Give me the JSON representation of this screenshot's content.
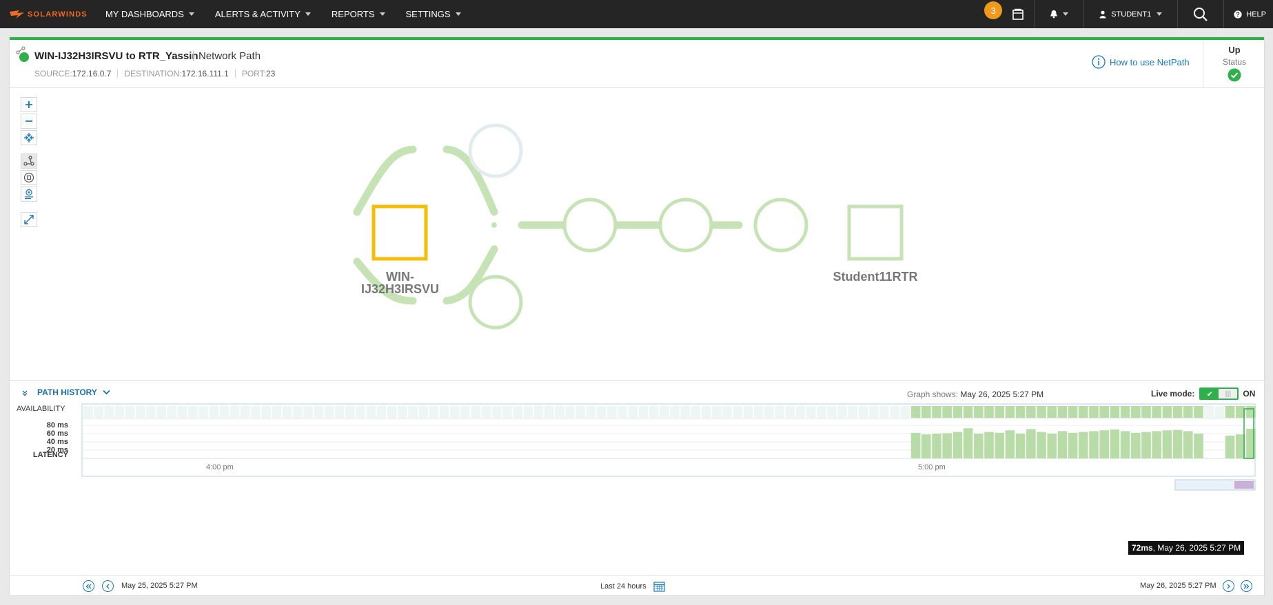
{
  "brand": {
    "name": "SOLARWINDS",
    "color": "#f16a21"
  },
  "nav": {
    "menus": [
      "MY DASHBOARDS",
      "ALERTS & ACTIVITY",
      "REPORTS",
      "SETTINGS"
    ],
    "notification_count": "3",
    "user": "STUDENT1",
    "help": "HELP"
  },
  "header": {
    "title": "WIN-IJ32H3IRSVU to RTR_Yassin",
    "subtitle": "Network Path",
    "source_label": "SOURCE:",
    "source": "172.16.0.7",
    "destination_label": "DESTINATION:",
    "destination": "172.16.111.1",
    "port_label": "PORT:",
    "port": "23",
    "how_to": "How to use NetPath",
    "status_value": "Up",
    "status_label": "Status"
  },
  "map": {
    "source_node": "WIN-\nIJ32H3IRSVU",
    "dest_node": "Student11RTR",
    "colors": {
      "path": "#c5e3b5",
      "source_border": "#f5bd06",
      "unknown_hop": "#e2ecf0"
    }
  },
  "history": {
    "title": "PATH HISTORY",
    "graph_shows_label": "Graph shows:",
    "graph_shows_value": "May 26, 2025 5:27 PM",
    "live_mode_label": "Live mode:",
    "live_mode_state": "ON",
    "availability_label": "AVAILABILITY",
    "latency_label": "LATENCY",
    "latency_ticks": [
      "80 ms",
      "60 ms",
      "40 ms",
      "20 ms"
    ],
    "time_labels": [
      "4:00 pm",
      "5:00 pm"
    ],
    "tooltip_value": "72ms",
    "tooltip_time": ", May 26, 2025 5:27 PM",
    "latency_bars_ms": [
      62,
      58,
      60,
      61,
      64,
      73,
      60,
      64,
      62,
      68,
      60,
      71,
      64,
      60,
      66,
      62,
      64,
      66,
      68,
      70,
      66,
      62,
      64,
      66,
      68,
      69,
      66,
      60,
      null,
      null,
      55,
      58,
      72
    ],
    "range_start": "May 25, 2025 5:27 PM",
    "range_label": "Last 24 hours",
    "range_end": "May 26, 2025 5:27 PM"
  }
}
